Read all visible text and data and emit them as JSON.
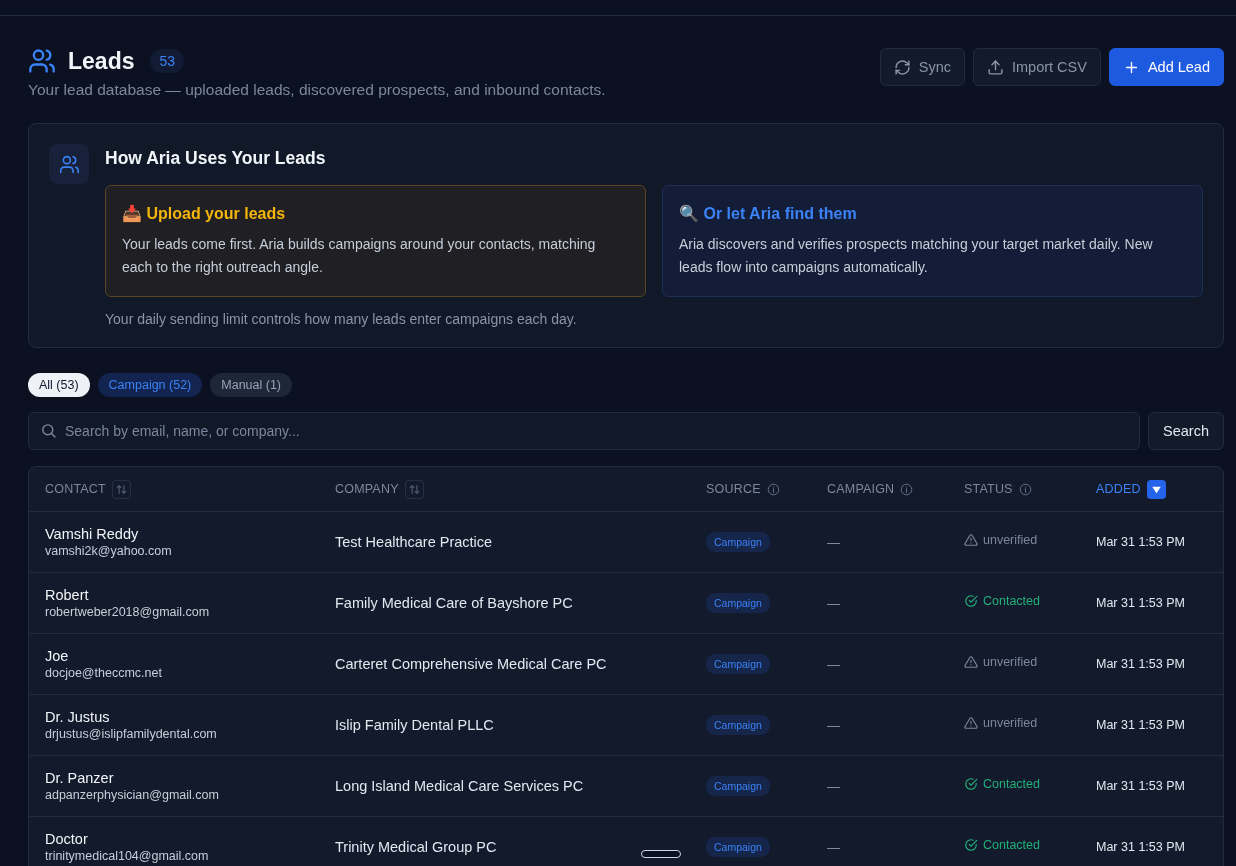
{
  "header": {
    "title": "Leads",
    "count": "53",
    "subtitle": "Your lead database — uploaded leads, discovered prospects, and inbound contacts."
  },
  "actions": [
    {
      "label": "Sync",
      "kind": "sync"
    },
    {
      "label": "Import CSV",
      "kind": "import"
    },
    {
      "label": "Add Lead",
      "kind": "add"
    }
  ],
  "info_card": {
    "title": "How Aria Uses Your Leads",
    "options": [
      {
        "title": "📥 Upload your leads",
        "text": "Your leads come first. Aria builds campaigns around your contacts, matching each to the right outreach angle.",
        "kind": "upload"
      },
      {
        "title": "🔍 Or let Aria find them",
        "text": "Aria discovers and verifies prospects matching your target market daily. New leads flow into campaigns automatically.",
        "kind": "discover"
      }
    ],
    "note": "Your daily sending limit controls how many leads enter campaigns each day."
  },
  "filters": [
    {
      "label": "All (53)",
      "selected": true,
      "kind": "all"
    },
    {
      "label": "Campaign (52)",
      "selected": false,
      "kind": "campaign"
    },
    {
      "label": "Manual (1)",
      "selected": false,
      "kind": "manual"
    }
  ],
  "search": {
    "placeholder": "Search by email, name, or company...",
    "button": "Search"
  },
  "table": {
    "columns": [
      {
        "label": "CONTACT",
        "kind": "sort",
        "selected": false
      },
      {
        "label": "COMPANY",
        "kind": "sort",
        "selected": false
      },
      {
        "label": "SOURCE",
        "kind": "info",
        "selected": false
      },
      {
        "label": "CAMPAIGN",
        "kind": "info",
        "selected": false
      },
      {
        "label": "STATUS",
        "kind": "info",
        "selected": false
      },
      {
        "label": "ADDED",
        "kind": "sort",
        "selected": true
      }
    ],
    "rows": [
      {
        "name": "Vamshi Reddy",
        "email": "vamshi2k@yahoo.com",
        "company": "Test Healthcare Practice",
        "source": "Campaign",
        "campaign": "—",
        "status": {
          "text": "unverified",
          "kind": "warning"
        },
        "added": "Mar 31 1:53 PM"
      },
      {
        "name": "Robert",
        "email": "robertweber2018@gmail.com",
        "company": "Family Medical Care of Bayshore PC",
        "source": "Campaign",
        "campaign": "—",
        "status": {
          "text": "Contacted",
          "kind": "done"
        },
        "added": "Mar 31 1:53 PM"
      },
      {
        "name": "Joe",
        "email": "docjoe@theccmc.net",
        "company": "Carteret Comprehensive Medical Care PC",
        "source": "Campaign",
        "campaign": "—",
        "status": {
          "text": "unverified",
          "kind": "warning"
        },
        "added": "Mar 31 1:53 PM"
      },
      {
        "name": "Dr. Justus",
        "email": "drjustus@islipfamilydental.com",
        "company": "Islip Family Dental PLLC",
        "source": "Campaign",
        "campaign": "—",
        "status": {
          "text": "unverified",
          "kind": "warning"
        },
        "added": "Mar 31 1:53 PM"
      },
      {
        "name": "Dr. Panzer",
        "email": "adpanzerphysician@gmail.com",
        "company": "Long Island Medical Care Services PC",
        "source": "Campaign",
        "campaign": "—",
        "status": {
          "text": "Contacted",
          "kind": "done"
        },
        "added": "Mar 31 1:53 PM"
      },
      {
        "name": "Doctor",
        "email": "trinitymedical104@gmail.com",
        "company": "Trinity Medical Group PC",
        "source": "Campaign",
        "campaign": "—",
        "status": {
          "text": "Contacted",
          "kind": "done"
        },
        "added": "Mar 31 1:53 PM"
      }
    ]
  }
}
